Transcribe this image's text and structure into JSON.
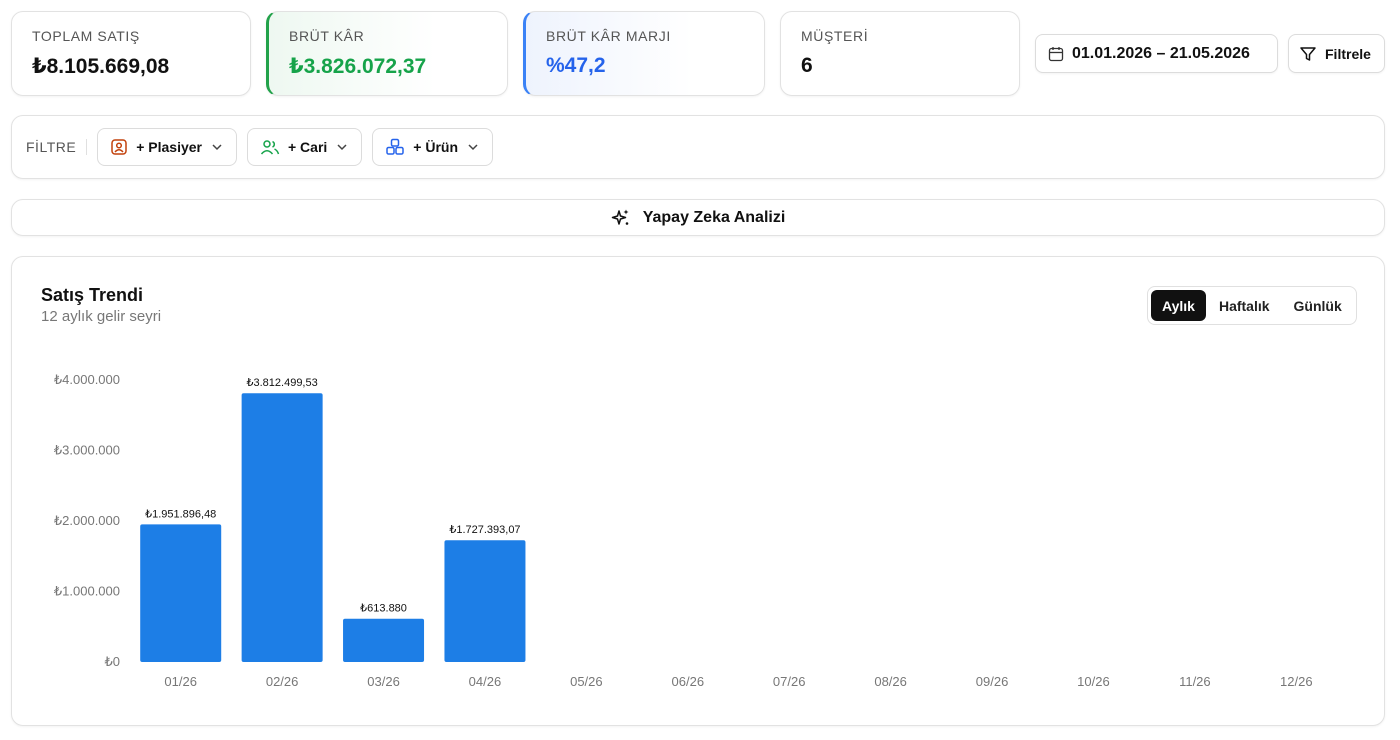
{
  "kpis": [
    {
      "label": "TOPLAM SATIŞ",
      "value": "₺8.105.669,08"
    },
    {
      "label": "BRÜT KÂR",
      "value": "₺3.826.072,37"
    },
    {
      "label": "BRÜT KÂR MARJI",
      "value": "%47,2"
    },
    {
      "label": "MÜŞTERİ",
      "value": "6"
    }
  ],
  "date_range": "01.01.2026 – 21.05.2026",
  "filter_button": "Filtrele",
  "filter_bar": {
    "label": "FİLTRE",
    "chips": [
      {
        "label": "+ Plasiyer",
        "icon": "user-card-icon"
      },
      {
        "label": "+ Cari",
        "icon": "users-icon"
      },
      {
        "label": "+ Ürün",
        "icon": "boxes-icon"
      }
    ]
  },
  "ai_button": "Yapay Zeka Analizi",
  "chart": {
    "title": "Satış Trendi",
    "subtitle": "12 aylık gelir seyri",
    "tabs": [
      "Aylık",
      "Haftalık",
      "Günlük"
    ],
    "active_tab": "Aylık"
  },
  "colors": {
    "bar": "#1d7ee6",
    "green": "#16a34a",
    "blue": "#2563eb"
  },
  "chart_data": {
    "type": "bar",
    "categories": [
      "01/26",
      "02/26",
      "03/26",
      "04/26",
      "05/26",
      "06/26",
      "07/26",
      "08/26",
      "09/26",
      "10/26",
      "11/26",
      "12/26"
    ],
    "values": [
      1951896.48,
      3812499.53,
      613880,
      1727393.07,
      0,
      0,
      0,
      0,
      0,
      0,
      0,
      0
    ],
    "value_labels": [
      "₺1.951.896,48",
      "₺3.812.499,53",
      "₺613.880",
      "₺1.727.393,07",
      "",
      "",
      "",
      "",
      "",
      "",
      "",
      ""
    ],
    "yticks": [
      0,
      1000000,
      2000000,
      3000000,
      4000000
    ],
    "ytick_labels": [
      "₺0",
      "₺1.000.000",
      "₺2.000.000",
      "₺3.000.000",
      "₺4.000.000"
    ],
    "ylim": [
      0,
      4000000
    ],
    "grid": false
  }
}
